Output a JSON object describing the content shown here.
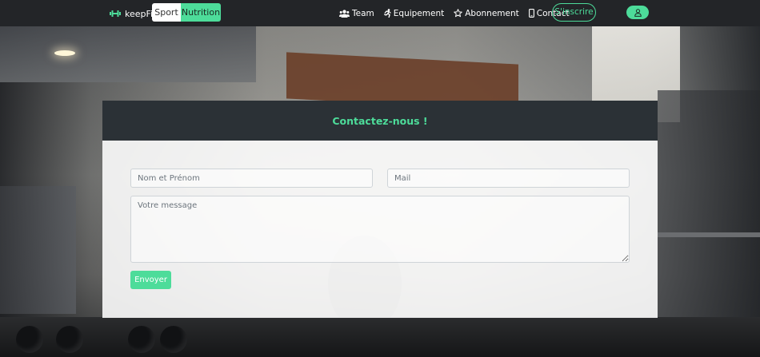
{
  "navbar": {
    "brand": "keepFit",
    "toggle": {
      "sport": "Sport",
      "nutrition": "Nutrition"
    },
    "links": [
      {
        "label": "Team",
        "icon": "users-icon"
      },
      {
        "label": "Equipement",
        "icon": "running-person-icon"
      },
      {
        "label": "Abonnement",
        "icon": "star-icon"
      },
      {
        "label": "Contact",
        "icon": "mobile-phone-icon"
      }
    ],
    "signup_label": "S'inscrire",
    "user_icon": "user-icon"
  },
  "contact": {
    "title": "Contactez-nous !",
    "name_placeholder": "Nom et Prénom",
    "mail_placeholder": "Mail",
    "message_placeholder": "Votre message",
    "submit_label": "Envoyer"
  },
  "colors": {
    "accent": "#4ddc9a",
    "navbar_bg": "#232528",
    "card_header_bg": "#2b3136"
  }
}
